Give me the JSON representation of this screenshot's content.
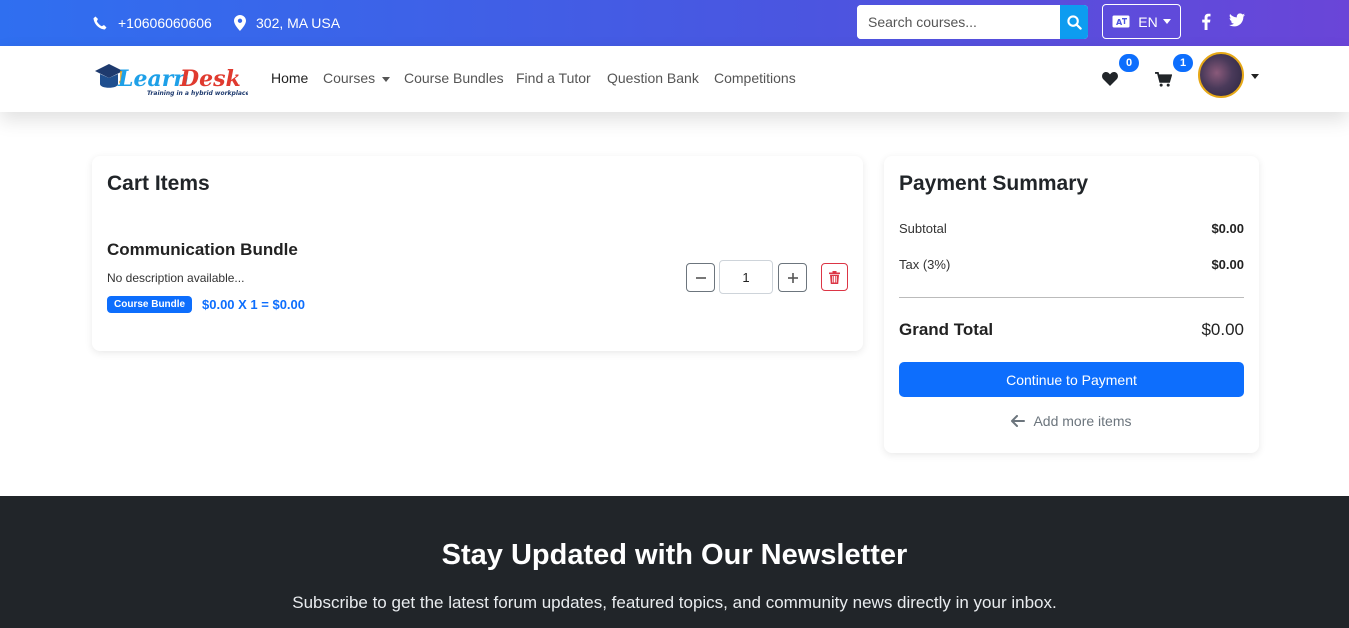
{
  "topbar": {
    "phone": "+10606060606",
    "location": "302, MA USA",
    "search_placeholder": "Search courses...",
    "language": "EN",
    "icons": [
      "phone-icon",
      "map-pin-icon",
      "search-icon",
      "language-icon",
      "facebook-icon",
      "twitter-icon"
    ]
  },
  "navbar": {
    "logo_name": "LearnDesk",
    "logo_tagline": "Training in a hybrid workplace",
    "links": [
      "Home",
      "Courses",
      "Course Bundles",
      "Find a Tutor",
      "Question Bank",
      "Competitions"
    ],
    "wishlist_count": "0",
    "cart_count": "1"
  },
  "cart": {
    "title": "Cart Items",
    "item": {
      "name": "Communication Bundle",
      "description": "No description available...",
      "type_badge": "Course Bundle",
      "price_line": "$0.00 X 1 = $0.00",
      "quantity": "1"
    }
  },
  "summary": {
    "title": "Payment Summary",
    "subtotal_label": "Subtotal",
    "subtotal_value": "$0.00",
    "tax_label": "Tax (3%)",
    "tax_value": "$0.00",
    "grand_total_label": "Grand Total",
    "grand_total_value": "$0.00",
    "pay_button": "Continue to Payment",
    "add_more": "Add more items"
  },
  "newsletter": {
    "title": "Stay Updated with Our Newsletter",
    "subtitle": "Subscribe to get the latest forum updates, featured topics, and community news directly in your inbox."
  },
  "colors": {
    "primary": "#0d6efd",
    "danger": "#dc3545",
    "dark_footer": "#212529",
    "topbar_start": "#2f6ff0",
    "topbar_end": "#6a45d8"
  }
}
